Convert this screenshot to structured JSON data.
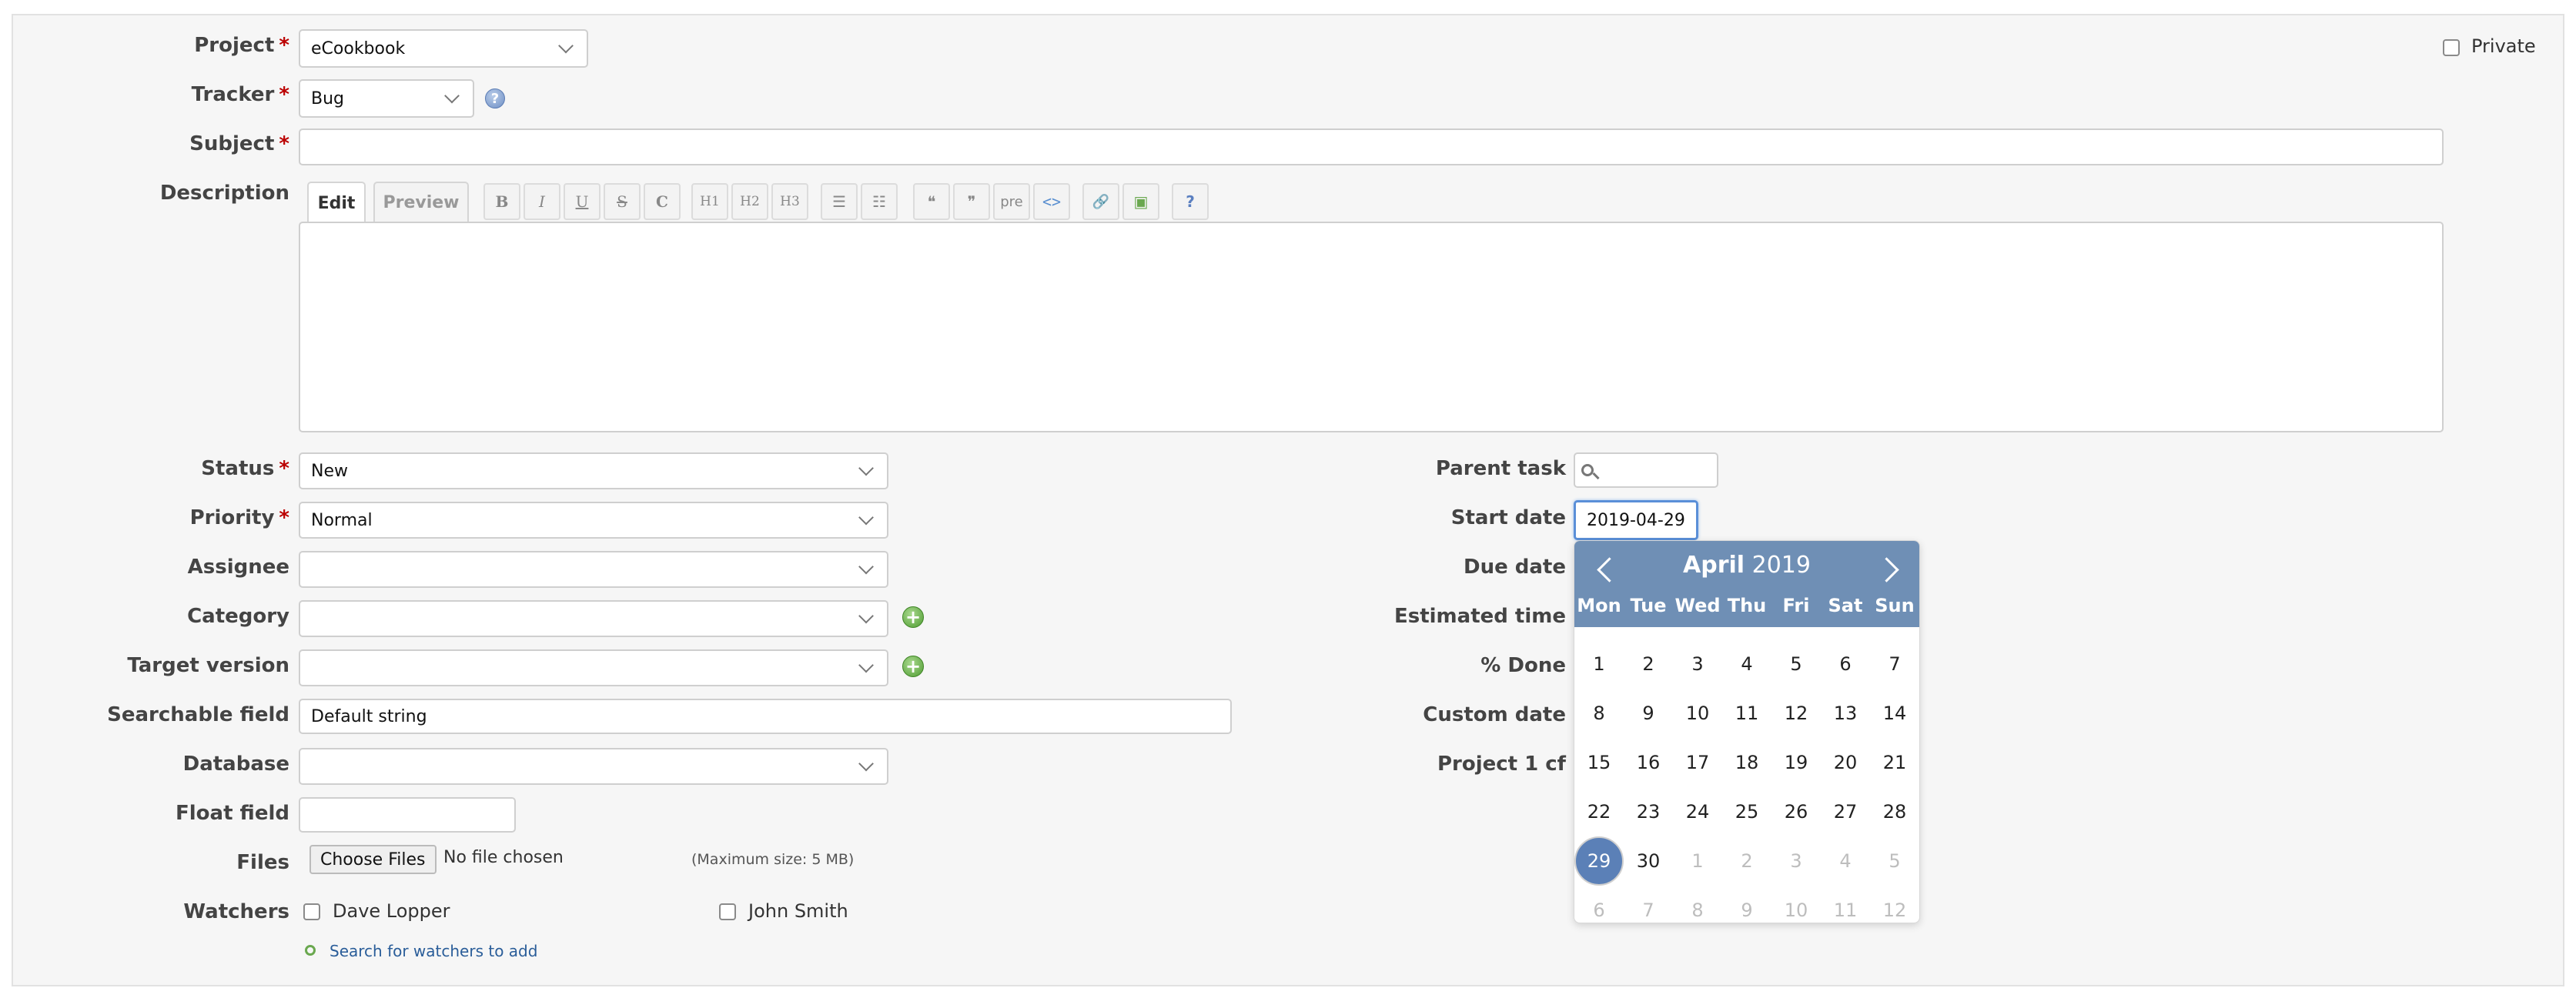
{
  "form": {
    "project": {
      "label": "Project",
      "value": "eCookbook"
    },
    "private_label": "Private",
    "tracker": {
      "label": "Tracker",
      "value": "Bug"
    },
    "subject": {
      "label": "Subject",
      "value": ""
    },
    "description": {
      "label": "Description"
    },
    "required_mark": "*"
  },
  "editor": {
    "tabs": [
      "Edit",
      "Preview"
    ],
    "toolbar": [
      {
        "icon": "bold-icon",
        "glyph": "B"
      },
      {
        "icon": "italic-icon",
        "glyph": "I"
      },
      {
        "icon": "underline-icon",
        "glyph": "U"
      },
      {
        "icon": "strikethrough-icon",
        "glyph": "S"
      },
      {
        "icon": "code-inline-icon",
        "glyph": "C"
      },
      {
        "icon": "heading1-icon",
        "glyph": "H1"
      },
      {
        "icon": "heading2-icon",
        "glyph": "H2"
      },
      {
        "icon": "heading3-icon",
        "glyph": "H3"
      },
      {
        "icon": "unordered-list-icon",
        "glyph": "☰"
      },
      {
        "icon": "ordered-list-icon",
        "glyph": "☷"
      },
      {
        "icon": "quote-icon",
        "glyph": "❝"
      },
      {
        "icon": "unquote-icon",
        "glyph": "❞"
      },
      {
        "icon": "preformatted-icon",
        "glyph": "pre"
      },
      {
        "icon": "code-block-icon",
        "glyph": "<>"
      },
      {
        "icon": "link-icon",
        "glyph": "🔗"
      },
      {
        "icon": "image-icon",
        "glyph": "▣"
      },
      {
        "icon": "help-icon",
        "glyph": "?"
      }
    ]
  },
  "left": {
    "status": {
      "label": "Status",
      "value": "New"
    },
    "priority": {
      "label": "Priority",
      "value": "Normal"
    },
    "assignee": {
      "label": "Assignee",
      "value": ""
    },
    "category": {
      "label": "Category",
      "value": ""
    },
    "target_version": {
      "label": "Target version",
      "value": ""
    },
    "searchable": {
      "label": "Searchable field",
      "value": "Default string"
    },
    "database": {
      "label": "Database",
      "value": ""
    },
    "float_field": {
      "label": "Float field",
      "value": ""
    },
    "files": {
      "label": "Files",
      "button": "Choose Files",
      "status": "No file chosen",
      "max": "(Maximum size: 5 MB)"
    },
    "watchers": {
      "label": "Watchers",
      "users": [
        "Dave Lopper",
        "John Smith"
      ],
      "search_link": "Search for watchers to add"
    }
  },
  "right": {
    "parent_task": {
      "label": "Parent task",
      "value": ""
    },
    "start_date": {
      "label": "Start date",
      "value": "2019-04-29"
    },
    "due_date": {
      "label": "Due date"
    },
    "estimated_time": {
      "label": "Estimated time"
    },
    "done": {
      "label": "% Done"
    },
    "custom_date": {
      "label": "Custom date"
    },
    "project1_cf": {
      "label": "Project 1 cf"
    }
  },
  "calendar": {
    "month": "April",
    "year": "2019",
    "weekdays": [
      "Mon",
      "Tue",
      "Wed",
      "Thu",
      "Fri",
      "Sat",
      "Sun"
    ],
    "weeks": [
      [
        "1",
        "2",
        "3",
        "4",
        "5",
        "6",
        "7"
      ],
      [
        "8",
        "9",
        "10",
        "11",
        "12",
        "13",
        "14"
      ],
      [
        "15",
        "16",
        "17",
        "18",
        "19",
        "20",
        "21"
      ],
      [
        "22",
        "23",
        "24",
        "25",
        "26",
        "27",
        "28"
      ],
      [
        "29",
        "30",
        "1",
        "2",
        "3",
        "4",
        "5"
      ],
      [
        "6",
        "7",
        "8",
        "9",
        "10",
        "11",
        "12"
      ]
    ],
    "selected": "29"
  }
}
